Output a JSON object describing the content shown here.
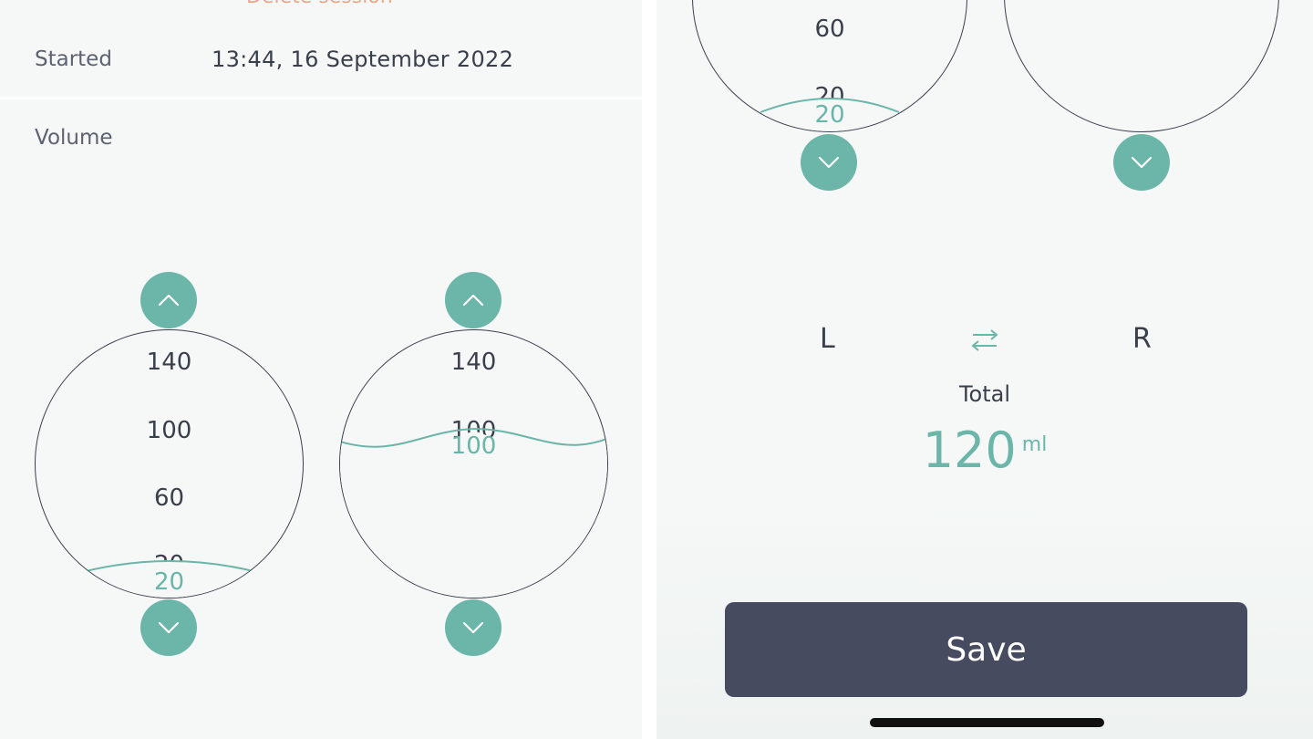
{
  "header": {
    "delete_session_label": "Delete session"
  },
  "session": {
    "started_label": "Started",
    "started_value": "13:44, 16 September 2022",
    "volume_label": "Volume"
  },
  "left_bottle": {
    "ticks": [
      "140",
      "100",
      "60",
      "20"
    ],
    "fill_value": "20",
    "fill_ml": 20
  },
  "right_bottle": {
    "ticks": [
      "140",
      "100",
      "60",
      "20"
    ],
    "fill_value": "100",
    "fill_ml": 100
  },
  "sides": {
    "left": "L",
    "right": "R"
  },
  "total": {
    "label": "Total",
    "value": "120",
    "unit": "ml"
  },
  "actions": {
    "save_label": "Save"
  },
  "colors": {
    "accent": "#6cb5a9",
    "button": "#464b5f",
    "text": "#3a3f4c",
    "delete": "#e9a98b"
  },
  "icons": {
    "increase": "chevron-up-icon",
    "decrease": "chevron-down-icon",
    "swap": "swap-arrows-icon"
  }
}
